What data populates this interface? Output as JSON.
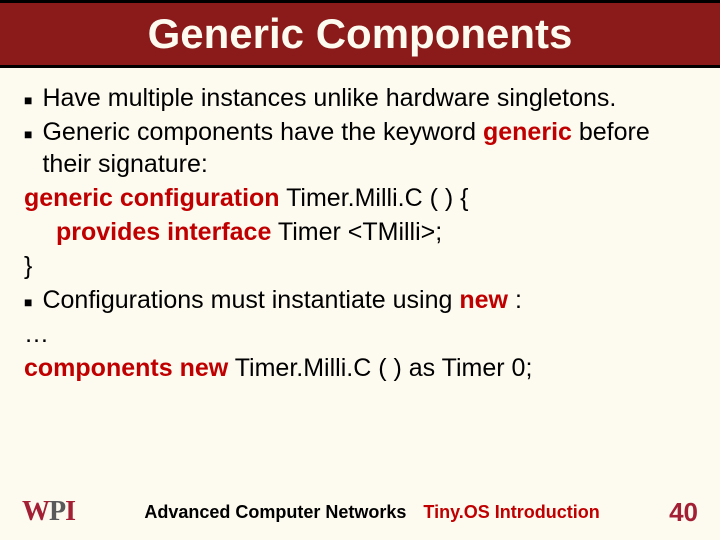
{
  "title": "Generic Components",
  "bullets": {
    "b1": "Have multiple instances unlike hardware singletons.",
    "b2_pre": "Generic components have the keyword ",
    "b2_kw": "generic",
    "b2_post": " before their signature:"
  },
  "code": {
    "line1_kw": "generic configuration",
    "line1_rest": " Timer.Milli.C ( ) {",
    "line2_kw": "provides interface",
    "line2_rest": " Timer <TMilli>;",
    "line3": "}"
  },
  "bullet3": {
    "pre": "Configurations must instantiate using ",
    "kw": "new",
    "post": " :"
  },
  "code2": {
    "ellipsis": "…",
    "line_kw1": "components",
    "line_mid": "  ",
    "line_kw2": "new",
    "line_rest": " Timer.Milli.C ( ) as Timer 0;"
  },
  "footer": {
    "logo_w": "W",
    "logo_p": "P",
    "logo_i": "I",
    "center1": "Advanced Computer Networks",
    "center2": "Tiny.OS Introduction",
    "page": "40"
  }
}
